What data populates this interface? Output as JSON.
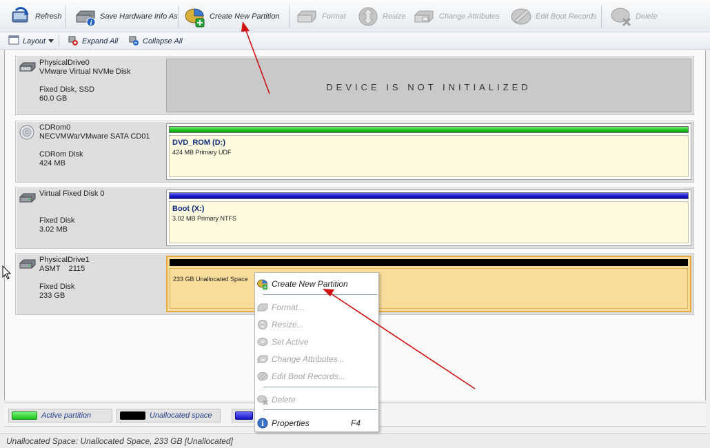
{
  "toolbar": {
    "refresh": "Refresh",
    "save_hardware": "Save Hardware Info As",
    "create_partition": "Create New Partition",
    "format": "Format",
    "resize": "Resize",
    "change_attributes": "Change Attributes",
    "edit_boot_records": "Edit Boot Records",
    "delete": "Delete"
  },
  "subbar": {
    "layout": "Layout",
    "expand_all": "Expand All",
    "collapse_all": "Collapse All"
  },
  "disks": [
    {
      "name": "PhysicalDrive0",
      "model": "VMware Virtual NVMe Disk",
      "type": "Fixed Disk, SSD",
      "size": "60.0 GB",
      "icon_badge": "SSD",
      "status_message": "DEVICE IS NOT INITIALIZED"
    },
    {
      "name": "CDRom0",
      "model": "NECVMWarVMware SATA CD01",
      "type": "CDRom Disk",
      "size": "424 MB",
      "partition": {
        "label": "DVD_ROM (D:)",
        "detail": "424 MB Primary UDF",
        "bar_color": "#22cc22"
      }
    },
    {
      "name": "Virtual Fixed Disk 0",
      "model": "",
      "type": "Fixed Disk",
      "size": "3.02 MB",
      "partition": {
        "label": "Boot (X:)",
        "detail": "3.02 MB Primary NTFS",
        "bar_color": "#1a1acc"
      }
    },
    {
      "name": "PhysicalDrive1",
      "model": "ASMT    2115",
      "type": "Fixed Disk",
      "size": "233 GB",
      "partition": {
        "label": "",
        "detail": "233 GB Unallocated Space",
        "bar_color": "#000000"
      }
    }
  ],
  "legend": [
    {
      "label": "Active partition",
      "color": "#22cc22"
    },
    {
      "label": "Unallocated space",
      "color": "#000000"
    },
    {
      "label": "",
      "color": "#1a1acc"
    }
  ],
  "context_menu": {
    "create_partition": "Create New Partition",
    "format": "Format...",
    "resize": "Resize...",
    "set_active": "Set Active",
    "change_attributes": "Change Attributes...",
    "edit_boot_records": "Edit Boot Records...",
    "delete": "Delete",
    "properties": "Properties",
    "properties_shortcut": "F4"
  },
  "status": {
    "text": "Unallocated Space: Unallocated Space, 233 GB [Unallocated]"
  },
  "colors": {
    "selected_partition_fill": "#f9dc9a",
    "selected_partition_border": "#e7a93b",
    "annotation_arrow": "#cc1111"
  }
}
